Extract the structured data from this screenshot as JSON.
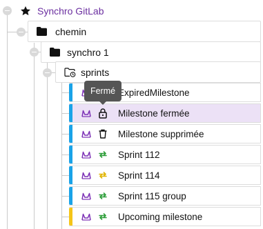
{
  "root": {
    "label": "Synchro GitLab",
    "icon": "star-icon",
    "label_color": "#6b2fa0"
  },
  "folder1": {
    "label": "chemin",
    "icon": "folder-icon"
  },
  "folder2": {
    "label": "synchro 1",
    "icon": "folder-icon"
  },
  "folder3": {
    "label": "sprints",
    "icon": "folder-sync-icon"
  },
  "tooltip": {
    "text": "Fermé"
  },
  "colors": {
    "accent_blue": "#1aa3e8",
    "accent_yellow": "#f5c518",
    "selected_bg": "#ece1f6",
    "gitlab_purple": "#7b2fb5",
    "sync_green": "#2e9e3a",
    "sync_yellow": "#e0b400"
  },
  "items": [
    {
      "label": "ExpiredMilestone",
      "status_icon": "sync-green-icon",
      "accent": "blue"
    },
    {
      "label": "Milestone fermée",
      "status_icon": "lock-icon",
      "accent": "blue",
      "selected": true
    },
    {
      "label": "Milestone supprimée",
      "status_icon": "trash-icon",
      "accent": "blue"
    },
    {
      "label": "Sprint 112",
      "status_icon": "sync-green-icon",
      "accent": "blue"
    },
    {
      "label": "Sprint 114",
      "status_icon": "sync-yellow-icon",
      "accent": "blue"
    },
    {
      "label": "Sprint 115 group",
      "status_icon": "sync-green-icon",
      "accent": "blue"
    },
    {
      "label": "Upcoming milestone",
      "status_icon": "sync-green-icon",
      "accent": "yellow"
    }
  ]
}
